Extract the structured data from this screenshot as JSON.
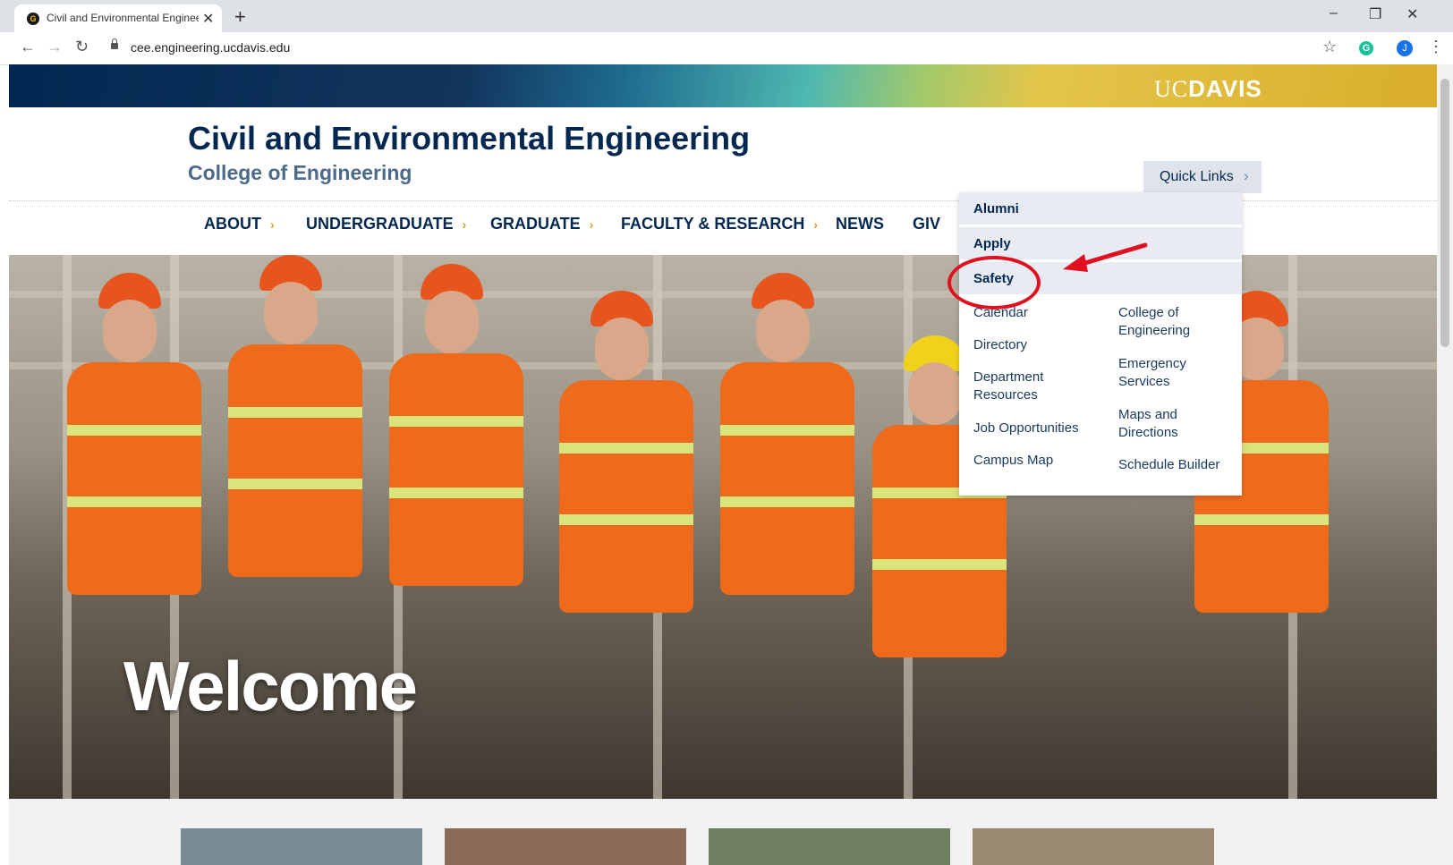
{
  "browser": {
    "tab_title": "Civil and Environmental Enginee",
    "tab_close": "✕",
    "new_tab": "+",
    "url": "cee.engineering.ucdavis.edu",
    "profile_initial": "J",
    "grammarly": "G",
    "controls": {
      "back": "←",
      "forward": "→",
      "reload": "↻",
      "star": "☆",
      "menu": "⋮",
      "min": "–",
      "restore": "❐",
      "close": "✕"
    }
  },
  "banner": {
    "logo_uc": "UC",
    "logo_davis": "DAVIS"
  },
  "header": {
    "title": "Civil and Environmental Engineering",
    "subtitle": "College of Engineering"
  },
  "quick_links": {
    "label": "Quick Links",
    "chevron": "›"
  },
  "nav": {
    "items": [
      {
        "label": "ABOUT",
        "chev": "›"
      },
      {
        "label": "UNDERGRADUATE",
        "chev": "›"
      },
      {
        "label": "GRADUATE",
        "chev": "›"
      },
      {
        "label": "FACULTY & RESEARCH",
        "chev": "›"
      },
      {
        "label": "NEWS"
      },
      {
        "label": "GIV"
      }
    ]
  },
  "dropdown": {
    "primary": [
      "Alumni",
      "Apply",
      "Safety"
    ],
    "col1": [
      "Calendar",
      "Directory",
      "Department Resources",
      "Job Opportunities",
      "Campus Map"
    ],
    "col2": [
      "College of Engineering",
      "Emergency Services",
      "Maps and Directions",
      "Schedule Builder"
    ]
  },
  "hero": {
    "text": "Welcome"
  },
  "colors": {
    "navy": "#022851",
    "gold": "#d9a21b",
    "annotation": "#e01020"
  }
}
